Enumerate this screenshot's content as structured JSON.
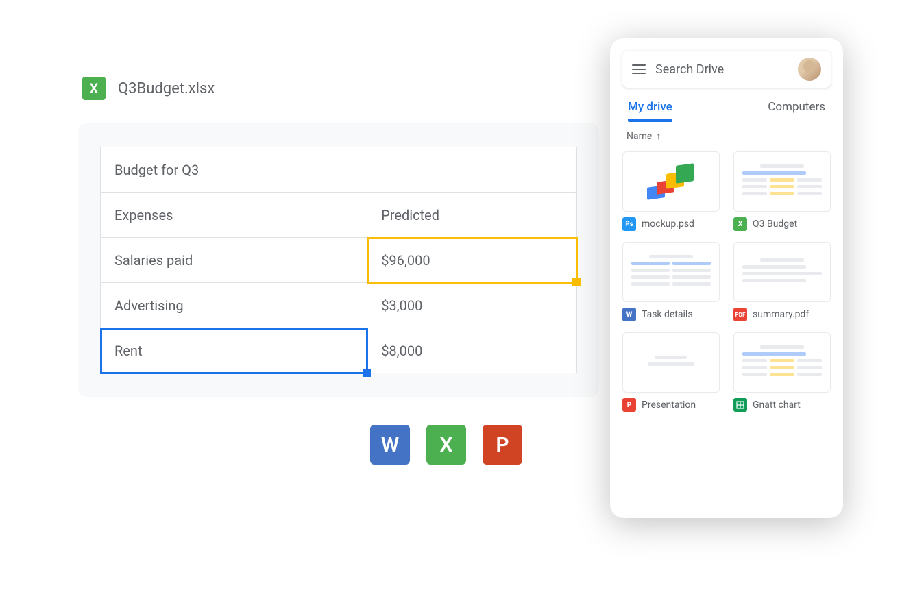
{
  "file": {
    "name": "Q3Budget.xlsx",
    "icon_letter": "X"
  },
  "sheet": {
    "rows": [
      {
        "a": "Budget for Q3",
        "b": ""
      },
      {
        "a": "Expenses",
        "b": "Predicted"
      },
      {
        "a": "Salaries paid",
        "b": "$96,000"
      },
      {
        "a": "Advertising",
        "b": "$3,000"
      },
      {
        "a": "Rent",
        "b": "$8,000"
      }
    ]
  },
  "bottom_icons": {
    "word": "W",
    "excel": "X",
    "ppt": "P"
  },
  "drive": {
    "search_placeholder": "Search Drive",
    "tabs": {
      "active": "My drive",
      "secondary": "Computers"
    },
    "sort": {
      "label": "Name",
      "arrow": "↑"
    },
    "files": [
      {
        "icon": "Ps",
        "name": "mockup.psd"
      },
      {
        "icon": "X",
        "name": "Q3 Budget"
      },
      {
        "icon": "W",
        "name": "Task details"
      },
      {
        "icon": "PDF",
        "name": "summary.pdf"
      },
      {
        "icon": "P",
        "name": "Presentation"
      },
      {
        "icon": "+",
        "name": "Gnatt chart"
      }
    ]
  }
}
